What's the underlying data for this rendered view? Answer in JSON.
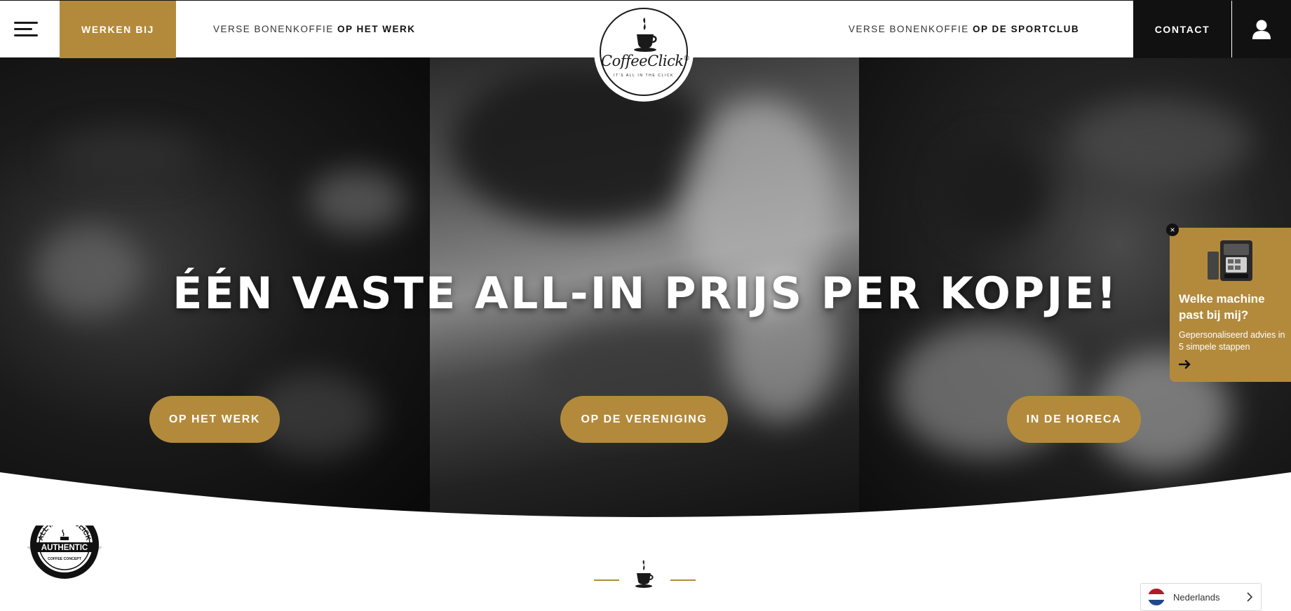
{
  "header": {
    "menu_icon": "hamburger-icon",
    "werken_bij": "WERKEN BIJ",
    "nav_left_prefix": "VERSE BONENKOFFIE",
    "nav_left_bold": "OP HET WERK",
    "nav_right_prefix": "VERSE BONENKOFFIE",
    "nav_right_bold": "OP DE SPORTCLUB",
    "contact": "CONTACT",
    "account_icon": "user-icon"
  },
  "logo": {
    "name": "CoffeeClick",
    "registered": "®",
    "tagline": "IT'S ALL IN THE CLICK"
  },
  "hero": {
    "headline": "ÉÉN VASTE ALL-IN PRIJS PER KOPJE!",
    "buttons": [
      {
        "label": "OP HET WERK"
      },
      {
        "label": "OP DE VERENIGING"
      },
      {
        "label": "IN DE HORECA"
      }
    ]
  },
  "widget": {
    "close": "×",
    "title": "Welke machine past bij mij?",
    "subtitle": "Gepersonaliseerd advies in 5 simpele stappen",
    "arrow_icon": "arrow-right-icon"
  },
  "badge": {
    "line1": "ALL IN THE CLICK",
    "line2": "AUTHENTIC",
    "line3": "COFFEE CONCEPT"
  },
  "language": {
    "label": "Nederlands",
    "flag_icon": "netherlands-flag-icon"
  },
  "colors": {
    "accent": "#b38a3c",
    "dark": "#111111",
    "white": "#ffffff"
  }
}
